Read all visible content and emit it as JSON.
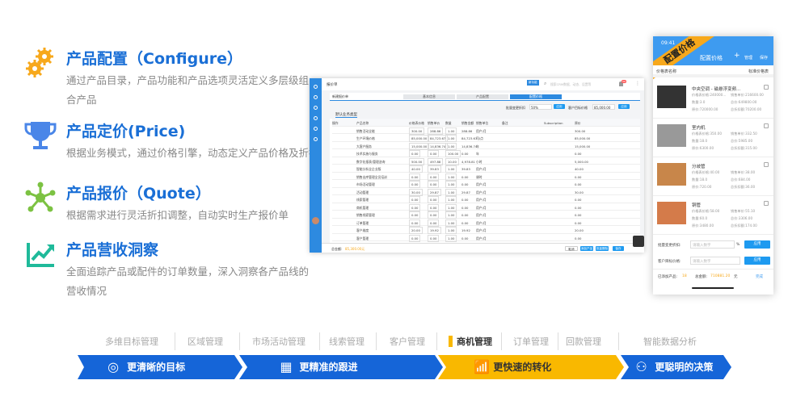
{
  "features": [
    {
      "title": "产品配置（Configure）",
      "desc": "通过产品目录，产品功能和产品选项灵活定义多层级组合产品",
      "icon": "gears-icon",
      "color": "#f7a81b"
    },
    {
      "title": "产品定价(Price)",
      "desc": "根据业务模式，通过价格引擎，动态定义产品价格及折扣",
      "icon": "trophy-icon",
      "color": "#4a86e8"
    },
    {
      "title": "产品报价（Quote）",
      "desc": "根据需求进行灵活折扣调整，自动实时生产报价单",
      "icon": "network-icon",
      "color": "#7cc242"
    },
    {
      "title": "产品营收洞察",
      "desc": "全面追踪产品或配件的订单数量，深入洞察各产品线的营收情况",
      "icon": "trend-chart-icon",
      "color": "#1fba9a"
    }
  ],
  "desktop": {
    "window_title": "报价单",
    "badge": "新功能",
    "search_placeholder": "搜索CRM数据、动态、设置等",
    "notif_count": "99",
    "page_title": "新建报价单",
    "steps": [
      "基本信息",
      "产品配置",
      "配置价格"
    ],
    "discount_label": "批量变更折扣",
    "discount_value": "50%",
    "apply": "应用",
    "target_label": "客户目标价格",
    "target_value": "85,000.00",
    "group_title": "默认业务类型",
    "headers": [
      "操作",
      "产品名称",
      "价格表价格",
      "销售单价",
      "数量",
      "销售金额",
      "销售单位",
      "备注",
      "Subscription",
      "原价"
    ],
    "rows": [
      [
        "销售活动全能",
        "300.00",
        "288.86",
        "1.00",
        "288.86",
        "用户/月",
        "300.00"
      ],
      [
        "生产环境价格",
        "85,000.00",
        "84,723.67",
        "1.00",
        "84,723.67",
        "司/点",
        "85,000.00"
      ],
      [
        "大客户服务",
        "15,000.00",
        "14,836.74",
        "1.00",
        "14,836.74",
        "年",
        "15,000.00"
      ],
      [
        "技术实施与服务",
        "0.00",
        "0.00",
        "100.00",
        "0.00",
        "年",
        "0.00"
      ],
      [
        "数字化报表/管理咨询",
        "500.00",
        "497.88",
        "10.00",
        "4,978.81",
        "小时",
        "5,000.00"
      ],
      [
        "智能分析全企业版",
        "40.00",
        "39.83",
        "1.00",
        "39.83",
        "用户/月",
        "40.00"
      ],
      [
        "销售出库管理全员培训",
        "0.00",
        "0.00",
        "1.00",
        "0.00",
        "课时",
        "0.00"
      ],
      [
        "市场活动管理",
        "0.00",
        "0.00",
        "1.00",
        "0.00",
        "用户/月",
        "0.00"
      ],
      [
        "活动管理",
        "30.00",
        "29.87",
        "1.00",
        "29.87",
        "用户/月",
        "30.00"
      ],
      [
        "线索管理",
        "0.00",
        "0.00",
        "1.00",
        "0.00",
        "用户/月",
        "0.00"
      ],
      [
        "商机管理",
        "0.00",
        "0.00",
        "1.00",
        "0.00",
        "用户/月",
        "0.00"
      ],
      [
        "销售线索管理",
        "0.00",
        "0.00",
        "1.00",
        "0.00",
        "用户/月",
        "0.00"
      ],
      [
        "订单管理",
        "0.00",
        "0.00",
        "1.00",
        "0.00",
        "用户/月",
        "0.00"
      ],
      [
        "客户维度",
        "20.00",
        "19.92",
        "1.00",
        "19.92",
        "用户/月",
        "20.00"
      ],
      [
        "客户管理",
        "0.00",
        "0.00",
        "1.00",
        "0.00",
        "用户/月",
        "0.00"
      ]
    ],
    "total_label": "总金额:",
    "total_value": "85,300.00元",
    "buttons": [
      "取消",
      "添加产品",
      "批量删除",
      "保存"
    ]
  },
  "mobile": {
    "time": "09:41",
    "ribbon": "配置价格",
    "title": "配置价格",
    "add": "+",
    "manage": "管理",
    "save": "保存",
    "pricebook_label": "价格表名称",
    "pricebook_value": "标准价格表",
    "items": [
      {
        "name": "中央空调 - 磁悬浮变频...",
        "list": "价格表价格:240000...",
        "sale": "销售单价:216600.00",
        "qty": "数量:3.0",
        "total": "总价:649800.00",
        "orig": "原价:720000.00",
        "disc": "总折扣额:70200.00"
      },
      {
        "name": "室内机",
        "list": "价格表价格:350.00",
        "sale": "销售单价:332.50",
        "qty": "数量:18.0",
        "total": "总价:5985.00",
        "orig": "原价:6300.00",
        "disc": "总折扣额:315.00"
      },
      {
        "name": "分歧管",
        "list": "价格表价格:40.00",
        "sale": "销售单价:38.00",
        "qty": "数量:18.0",
        "total": "总价:684.00",
        "orig": "原价:720.00",
        "disc": "总折扣额:36.00"
      },
      {
        "name": "铜管",
        "list": "价格表价格:58.00",
        "sale": "销售单价:55.10",
        "qty": "数量:60.0",
        "total": "总价:3306.00",
        "orig": "原价:3480.00",
        "disc": "总折扣额:174.00"
      }
    ],
    "discount_label": "批量变更折扣:",
    "target_label": "客户目标价格:",
    "placeholder": "请输入数字",
    "percent": "%",
    "apply": "应用",
    "added_label": "已添加产品:",
    "added_count": "18",
    "total_label": "总金额:",
    "total_value": "710881.20",
    "unit": "元",
    "done": "完成"
  },
  "nav": {
    "items": [
      "多维目标管理",
      "区域管理",
      "市场活动管理",
      "线索管理",
      "客户管理",
      "商机管理",
      "订单管理",
      "回款管理",
      "智能数据分析"
    ],
    "active": "商机管理"
  },
  "banner": [
    {
      "label": "更清晰的目标",
      "icon": "target-icon",
      "color": "#1565d8"
    },
    {
      "label": "更精准的跟进",
      "icon": "grid-search-icon",
      "color": "#1565d8"
    },
    {
      "label": "更快速的转化",
      "icon": "bar-chart-icon",
      "color": "#f9b800"
    },
    {
      "label": "更聪明的决策",
      "icon": "brain-network-icon",
      "color": "#1565d8"
    }
  ]
}
